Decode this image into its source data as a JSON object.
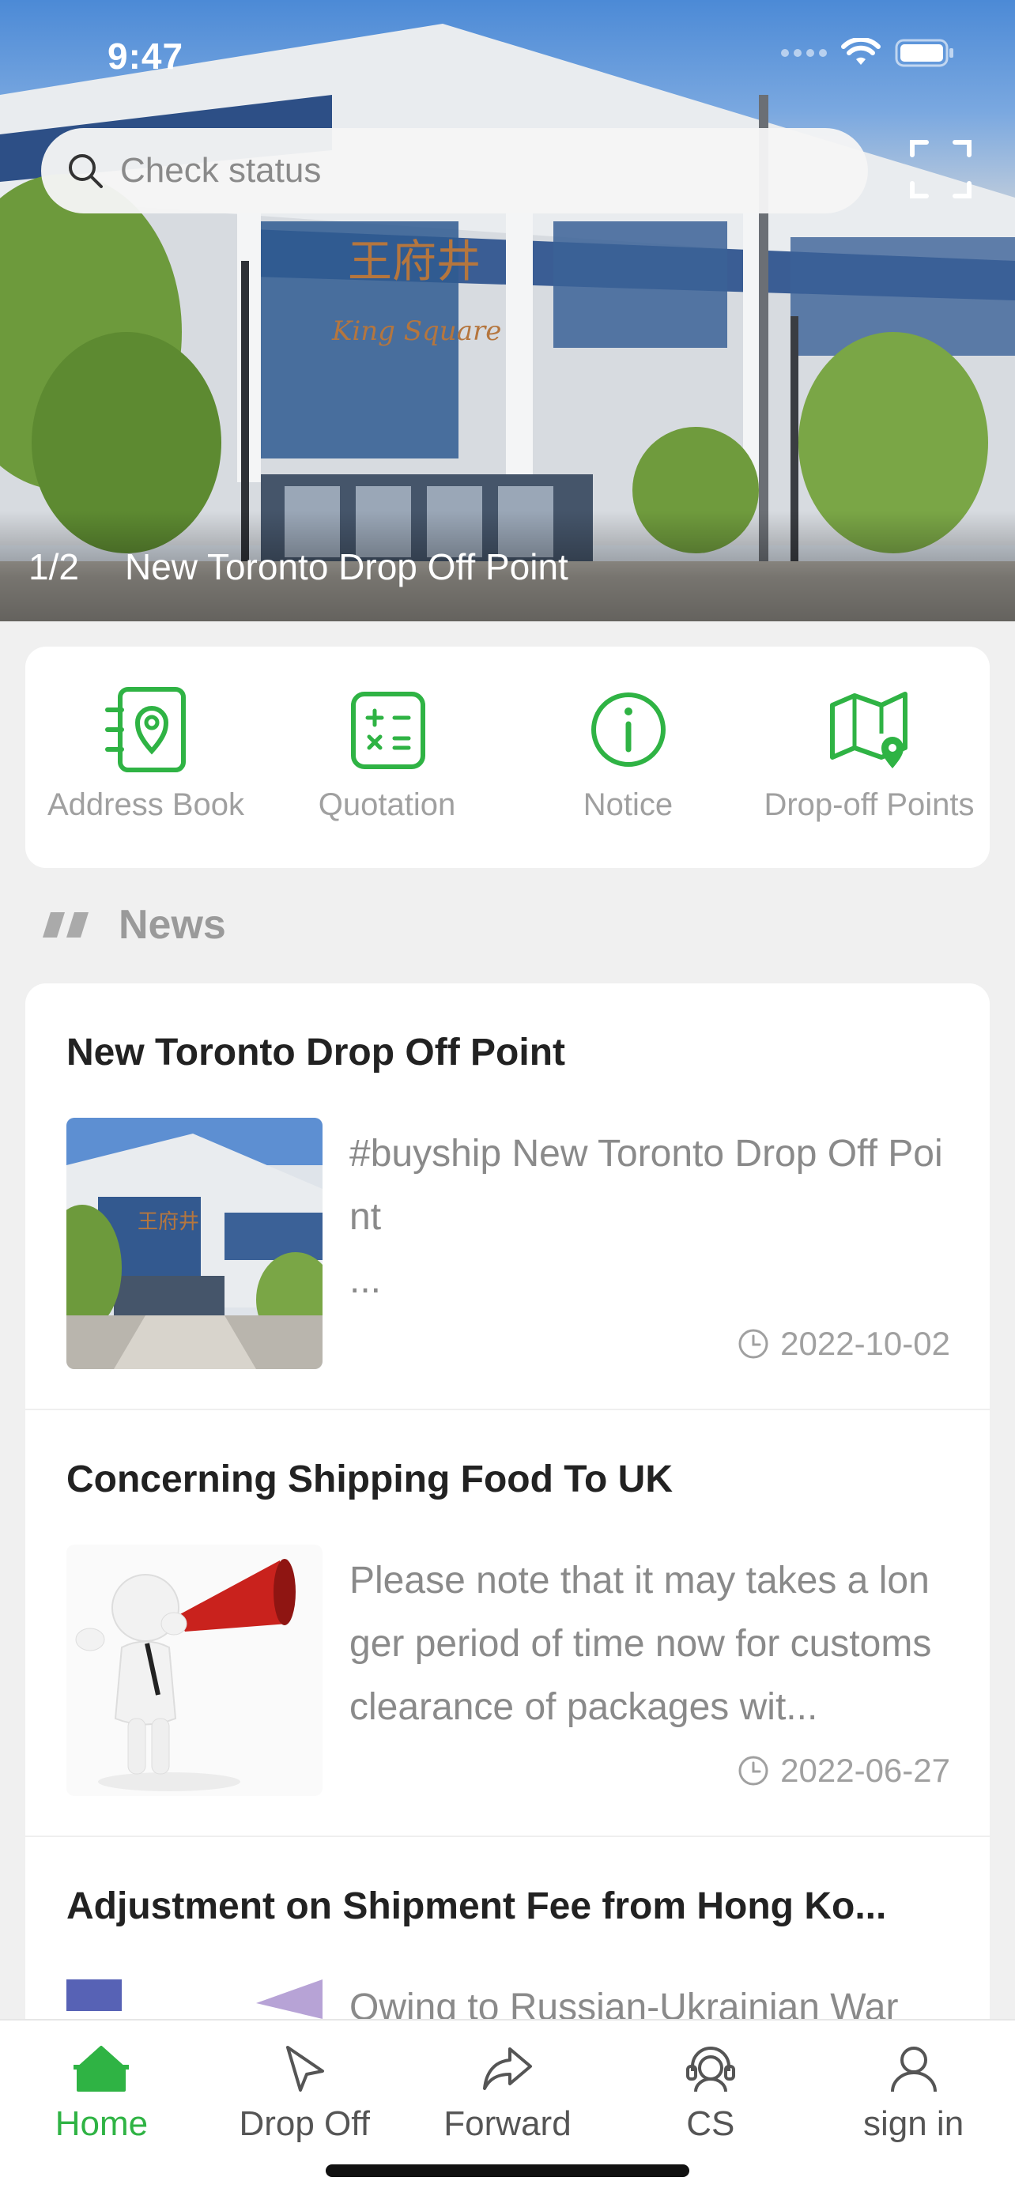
{
  "status_bar": {
    "time": "9:47"
  },
  "search": {
    "placeholder": "Check status"
  },
  "banner": {
    "counter": "1/2",
    "title": "New Toronto Drop Off Point"
  },
  "quick_actions": [
    {
      "label": "Address Book",
      "icon": "address-book-icon"
    },
    {
      "label": "Quotation",
      "icon": "calculator-icon"
    },
    {
      "label": "Notice",
      "icon": "info-icon"
    },
    {
      "label": "Drop-off Points",
      "icon": "map-pin-icon"
    }
  ],
  "news": {
    "heading": "News",
    "items": [
      {
        "title": "New Toronto Drop Off Point",
        "excerpt": "#buyship New Toronto Drop Off Point\n...",
        "date": "2022-10-02"
      },
      {
        "title": "Concerning Shipping Food To UK",
        "excerpt": "Please note that it may takes a longer period of time now for customs clearance of packages wit...",
        "date": "2022-06-27"
      },
      {
        "title": "Adjustment on Shipment Fee from Hong Ko...",
        "excerpt": "Owing to Russian-Ukrainian War",
        "date": ""
      }
    ]
  },
  "tabs": [
    {
      "label": "Home",
      "active": true
    },
    {
      "label": "Drop Off",
      "active": false
    },
    {
      "label": "Forward",
      "active": false
    },
    {
      "label": "CS",
      "active": false
    },
    {
      "label": "sign in",
      "active": false
    }
  ],
  "colors": {
    "accent": "#2fb344",
    "muted_text": "#8a8a8a"
  }
}
